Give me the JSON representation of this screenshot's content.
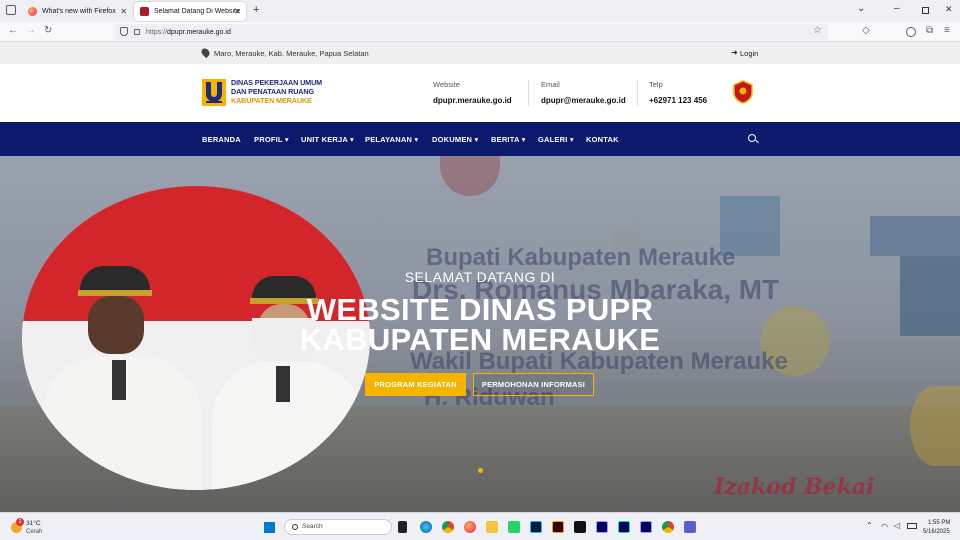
{
  "browser": {
    "tabs": [
      {
        "title": "What's new with Firefox",
        "active": false
      },
      {
        "title": "Selamat Datang Di Website Din",
        "active": true
      }
    ],
    "url": {
      "prefix": "https://",
      "domain": "dpupr.merauke.go.id"
    }
  },
  "site": {
    "topbar": {
      "location": "Maro, Merauke, Kab. Merauke, Papua Selatan",
      "login": "Login"
    },
    "logo": {
      "line1": "DINAS PEKERJAAN UMUM",
      "line2": "DAN PENATAAN RUANG",
      "line3": "KABUPATEN MERAUKE"
    },
    "contacts": [
      {
        "label": "Website",
        "value": "dpupr.merauke.go.id"
      },
      {
        "label": "Email",
        "value": "dpupr@merauke.go.id"
      },
      {
        "label": "Telp",
        "value": "+62971 123 456"
      }
    ],
    "nav": [
      {
        "label": "BERANDA",
        "dropdown": false
      },
      {
        "label": "PROFIL",
        "dropdown": true
      },
      {
        "label": "UNIT KERJA",
        "dropdown": true
      },
      {
        "label": "PELAYANAN",
        "dropdown": true
      },
      {
        "label": "DOKUMEN",
        "dropdown": true
      },
      {
        "label": "BERITA",
        "dropdown": true
      },
      {
        "label": "GALERI",
        "dropdown": true
      },
      {
        "label": "KONTAK",
        "dropdown": false
      }
    ],
    "hero": {
      "bg_line1": "Bupati Kabupaten Merauke",
      "bg_line2": "Drs. Romanus Mbaraka, MT",
      "bg_line3": "Wakil Bupati Kabupaten Merauke",
      "bg_line4": "H. Riduwan",
      "signature": "Izakod Bekai",
      "subtitle": "SELAMAT DATANG DI",
      "title_line1": "WEBSITE DINAS PUPR",
      "title_line2": "KABUPATEN MERAUKE",
      "button1": "PROGRAM KEGIATAN",
      "button2": "PERMOHONAN INFORMASI"
    }
  },
  "taskbar": {
    "weather": {
      "temp": "31°C",
      "condition": "Cerah",
      "badge": "2"
    },
    "search_placeholder": "Search",
    "time": "1:55 PM",
    "date": "5/16/2025"
  },
  "colors": {
    "navy": "#0c1a6e",
    "gold": "#f5b400",
    "logo_blue": "#1d2b7a"
  }
}
